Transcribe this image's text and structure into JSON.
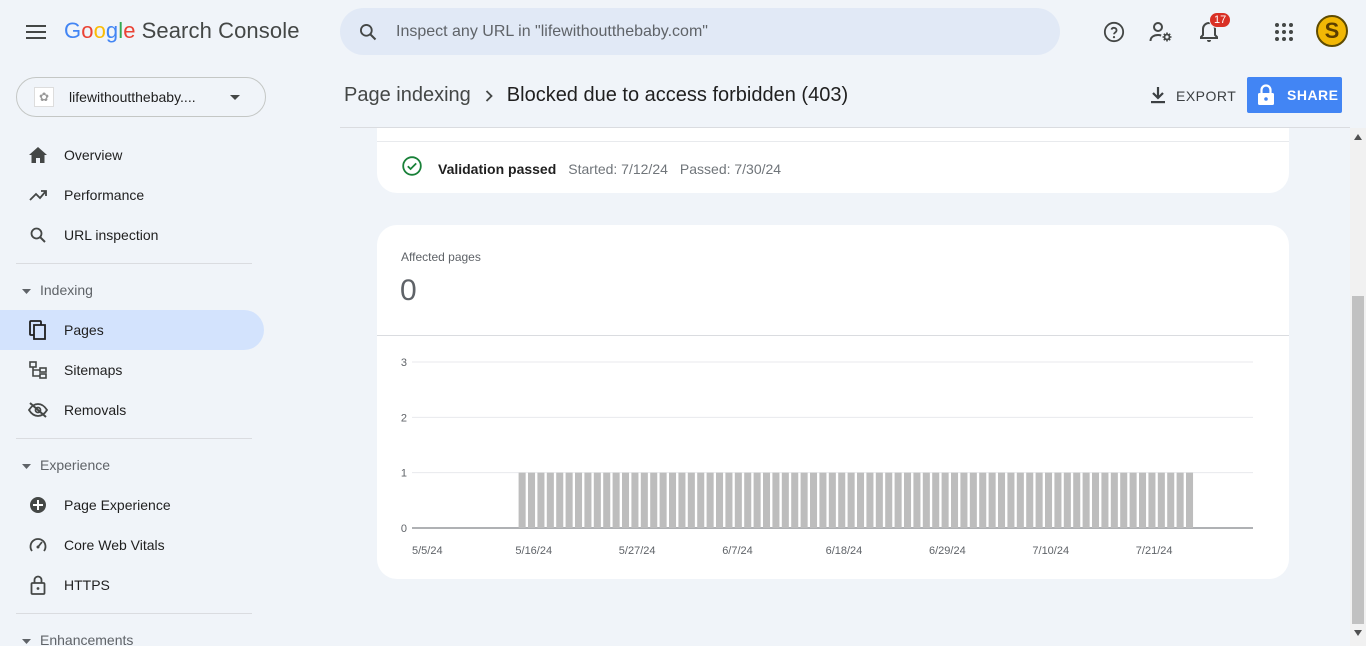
{
  "app": {
    "logo_letters": [
      "G",
      "o",
      "o",
      "g",
      "l",
      "e"
    ],
    "product_name": "Search Console"
  },
  "search": {
    "placeholder": "Inspect any URL in \"lifewithoutthebaby.com\""
  },
  "topbar": {
    "icons": [
      "help-icon",
      "manage-users-icon",
      "notifications-icon",
      "apps-grid-icon"
    ],
    "notification_count": "17",
    "avatar_letter": "S",
    "avatar_color": "#f2b705"
  },
  "property": {
    "name": "lifewithoutthebaby...."
  },
  "sidebar": {
    "items": [
      {
        "label": "Overview",
        "icon": "home-icon"
      },
      {
        "label": "Performance",
        "icon": "trending-up-icon"
      },
      {
        "label": "URL inspection",
        "icon": "search-icon"
      }
    ],
    "indexing": {
      "label": "Indexing",
      "items": [
        {
          "label": "Pages",
          "icon": "pages-icon",
          "active": true
        },
        {
          "label": "Sitemaps",
          "icon": "sitemap-icon"
        },
        {
          "label": "Removals",
          "icon": "removals-icon"
        }
      ]
    },
    "experience": {
      "label": "Experience",
      "items": [
        {
          "label": "Page Experience",
          "icon": "page-experience-icon"
        },
        {
          "label": "Core Web Vitals",
          "icon": "speedometer-icon"
        },
        {
          "label": "HTTPS",
          "icon": "lock-icon"
        }
      ]
    },
    "enhancements": {
      "label": "Enhancements"
    },
    "active_color": "#d3e3fd"
  },
  "header": {
    "breadcrumb_parent": "Page indexing",
    "breadcrumb_current": "Blocked due to access forbidden (403)",
    "export_label": "EXPORT",
    "share_label": "SHARE",
    "share_color": "#4285f4"
  },
  "validation": {
    "status": "Validation passed",
    "started": "Started: 7/12/24",
    "passed": "Passed: 7/30/24",
    "status_color": "#188038"
  },
  "affected": {
    "label": "Affected pages",
    "value": "0"
  },
  "chart_data": {
    "type": "bar",
    "title": "",
    "xlabel": "",
    "ylabel": "",
    "ylim": [
      0,
      3
    ],
    "y_ticks": [
      "0",
      "1",
      "2",
      "3"
    ],
    "x_tick_labels": [
      "5/5/24",
      "5/16/24",
      "5/27/24",
      "6/7/24",
      "6/18/24",
      "6/29/24",
      "7/10/24",
      "7/21/24"
    ],
    "start_date": "2024-05-05",
    "series": [
      {
        "color": "#bdbdbd",
        "values": [
          0,
          0,
          0,
          0,
          0,
          0,
          0,
          0,
          0,
          0,
          0,
          1,
          1,
          1,
          1,
          1,
          1,
          1,
          1,
          1,
          1,
          1,
          1,
          1,
          1,
          1,
          1,
          1,
          1,
          1,
          1,
          1,
          1,
          1,
          1,
          1,
          1,
          1,
          1,
          1,
          1,
          1,
          1,
          1,
          1,
          1,
          1,
          1,
          1,
          1,
          1,
          1,
          1,
          1,
          1,
          1,
          1,
          1,
          1,
          1,
          1,
          1,
          1,
          1,
          1,
          1,
          1,
          1,
          1,
          1,
          1,
          1,
          1,
          1,
          1,
          1,
          1,
          1,
          1,
          1,
          1,
          1,
          1
        ]
      }
    ]
  }
}
